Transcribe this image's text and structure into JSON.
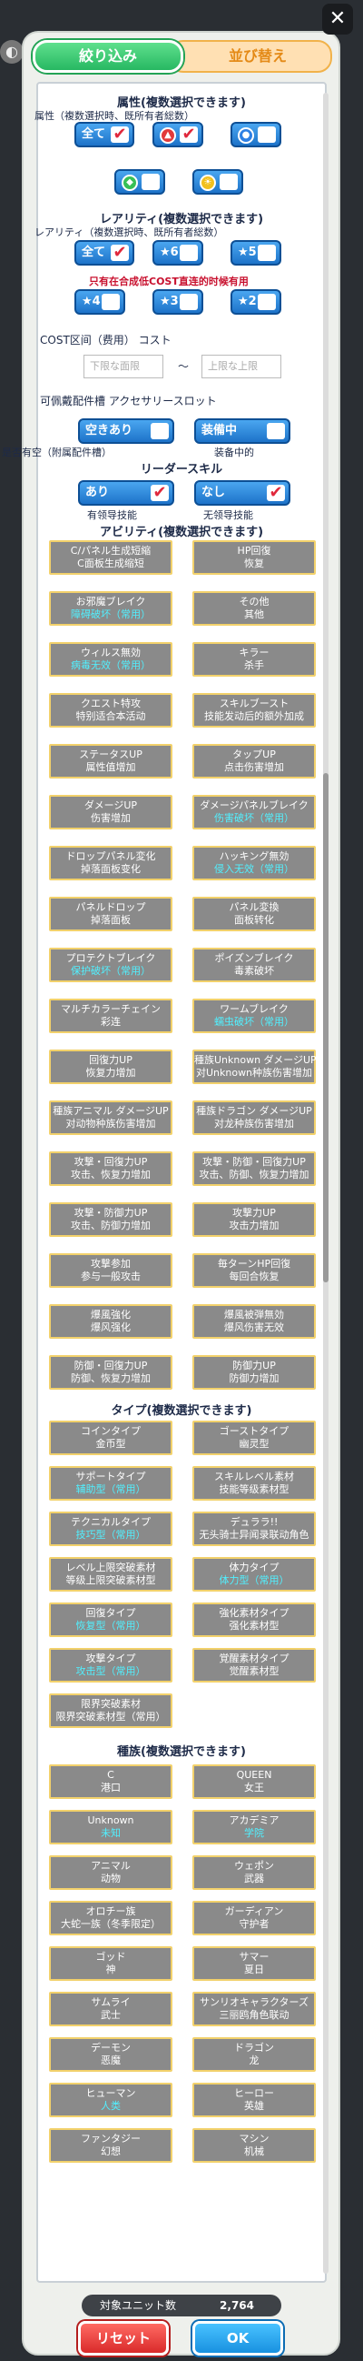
{
  "header": {
    "close": "✕",
    "tab_filter": "絞り込み",
    "tab_sort": "並び替え"
  },
  "attr": {
    "heading": "属性(複数選択できます)",
    "sub": "属性（複数選択時、既所有者総数）",
    "all": "全て",
    "fire": "✕",
    "water": "💧",
    "wind": "",
    "light": ""
  },
  "rarity": {
    "heading": "レアリティ(複数選択できます)",
    "sub": "レアリティ（複数選択時、既所有者総数）",
    "all": "全て",
    "r6": "★6",
    "r5": "★5",
    "note": "只有在合成低COST直连的时候有用",
    "r4": "★4",
    "r3": "★3",
    "r2": "★2"
  },
  "cost": {
    "sub": "COST区间（费用） コスト",
    "min_ph": "下限な面限",
    "tilde": "～",
    "max_ph": "上限な上限"
  },
  "accessory": {
    "sub": "可佩戴配件槽 アクセサリースロット",
    "free": "空きあり",
    "equipped": "装備中"
  },
  "leader": {
    "sub_left": "是否有空（附属配件槽）",
    "sub_right": "装备中的",
    "heading": "リーダースキル",
    "yes": "あり",
    "no": "なし",
    "yes_sub": "有领导技能",
    "no_sub": "无领导技能"
  },
  "ability": {
    "heading": "アビリティ(複数選択できます)",
    "items": [
      {
        "t": "C/パネル生成短縮",
        "s": "C面板生成缩短",
        "blue": false
      },
      {
        "t": "HP回復",
        "s": "恢复",
        "blue": false
      },
      {
        "t": "お邪魔ブレイク",
        "s": "障碍破坏（常用）",
        "blue": true
      },
      {
        "t": "その他",
        "s": "其他",
        "blue": false
      },
      {
        "t": "ウィルス無効",
        "s": "病毒无效（常用）",
        "blue": true
      },
      {
        "t": "キラー",
        "s": "杀手",
        "blue": false
      },
      {
        "t": "クエスト特攻",
        "s": "特别适合本活动",
        "blue": false
      },
      {
        "t": "スキルブースト",
        "s": "技能发动后的额外加成",
        "blue": false
      },
      {
        "t": "ステータスUP",
        "s": "属性值增加",
        "blue": false
      },
      {
        "t": "タップUP",
        "s": "点击伤害增加",
        "blue": false
      },
      {
        "t": "ダメージUP",
        "s": "伤害增加",
        "blue": false
      },
      {
        "t": "ダメージパネルブレイク",
        "s": "伤害破坏（常用）",
        "blue": true
      },
      {
        "t": "ドロップパネル変化",
        "s": "掉落面板变化",
        "blue": false
      },
      {
        "t": "ハッキング無効",
        "s": "侵入无效（常用）",
        "blue": true
      },
      {
        "t": "パネルドロップ",
        "s": "掉落面板",
        "blue": false
      },
      {
        "t": "パネル変換",
        "s": "面板转化",
        "blue": false
      },
      {
        "t": "プロテクトブレイク",
        "s": "保护破坏（常用）",
        "blue": true
      },
      {
        "t": "ポイズンブレイク",
        "s": "毒素破坏",
        "blue": false
      },
      {
        "t": "マルチカラーチェイン",
        "s": "彩连",
        "blue": false
      },
      {
        "t": "ワームブレイク",
        "s": "蠕虫破坏（常用）",
        "blue": true
      },
      {
        "t": "回復力UP",
        "s": "恢复力增加",
        "blue": false
      },
      {
        "t": "種族Unknown ダメージUP",
        "s": "对Unknown种族伤害增加",
        "blue": false
      },
      {
        "t": "種族アニマル ダメージUP",
        "s": "对动物种族伤害增加",
        "blue": false
      },
      {
        "t": "種族ドラゴン ダメージUP",
        "s": "对龙种族伤害增加",
        "blue": false
      },
      {
        "t": "攻撃・回復力UP",
        "s": "攻击、恢复力增加",
        "blue": false
      },
      {
        "t": "攻撃・防御・回復力UP",
        "s": "攻击、防御、恢复力增加",
        "blue": false
      },
      {
        "t": "攻撃・防御力UP",
        "s": "攻击、防御力增加",
        "blue": false
      },
      {
        "t": "攻撃力UP",
        "s": "攻击力增加",
        "blue": false
      },
      {
        "t": "攻撃参加",
        "s": "参与一般攻击",
        "blue": false
      },
      {
        "t": "毎ターンHP回復",
        "s": "每回合恢复",
        "blue": false
      },
      {
        "t": "爆風強化",
        "s": "爆风强化",
        "blue": false
      },
      {
        "t": "爆風被弾無効",
        "s": "爆风伤害无效",
        "blue": false
      },
      {
        "t": "防御・回復力UP",
        "s": "防御、恢复力增加",
        "blue": false
      },
      {
        "t": "防御力UP",
        "s": "防御力增加",
        "blue": false
      }
    ]
  },
  "type": {
    "heading": "タイプ(複数選択できます)",
    "items": [
      {
        "t": "コインタイプ",
        "s": "金币型",
        "blue": false
      },
      {
        "t": "ゴーストタイプ",
        "s": "幽灵型",
        "blue": false
      },
      {
        "t": "サポートタイプ",
        "s": "辅助型（常用）",
        "blue": true
      },
      {
        "t": "スキルレベル素材",
        "s": "技能等级素材型",
        "blue": false
      },
      {
        "t": "テクニカルタイプ",
        "s": "技巧型（常用）",
        "blue": true
      },
      {
        "t": "デュララ!!",
        "s": "无头骑士异闻录联动角色",
        "blue": false
      },
      {
        "t": "レベル上限突破素材",
        "s": "等级上限突破素材型",
        "blue": false
      },
      {
        "t": "体力タイプ",
        "s": "体力型（常用）",
        "blue": true
      },
      {
        "t": "回復タイプ",
        "s": "恢复型（常用）",
        "blue": true
      },
      {
        "t": "強化素材タイプ",
        "s": "强化素材型",
        "blue": false
      },
      {
        "t": "攻撃タイプ",
        "s": "攻击型（常用）",
        "blue": true
      },
      {
        "t": "覚醒素材タイプ",
        "s": "觉醒素材型",
        "blue": false
      },
      {
        "t": "限界突破素材",
        "s": "限界突破素材型（常用）",
        "blue": false
      }
    ]
  },
  "race": {
    "heading": "種族(複数選択できます)",
    "items": [
      {
        "t": "C",
        "s": "港口",
        "blue": false
      },
      {
        "t": "QUEEN",
        "s": "女王",
        "blue": false
      },
      {
        "t": "Unknown",
        "s": "未知",
        "blue": true
      },
      {
        "t": "アカデミア",
        "s": "学院",
        "blue": true
      },
      {
        "t": "アニマル",
        "s": "动物",
        "blue": false
      },
      {
        "t": "ウェポン",
        "s": "武器",
        "blue": false
      },
      {
        "t": "オロチー族",
        "s": "大蛇一族（冬季限定）",
        "blue": false
      },
      {
        "t": "ガーディアン",
        "s": "守护者",
        "blue": false
      },
      {
        "t": "ゴッド",
        "s": "神",
        "blue": false
      },
      {
        "t": "サマー",
        "s": "夏日",
        "blue": false
      },
      {
        "t": "サムライ",
        "s": "武士",
        "blue": false
      },
      {
        "t": "サンリオキャラクターズ",
        "s": "三丽鸥角色联动",
        "blue": false
      },
      {
        "t": "デーモン",
        "s": "恶魔",
        "blue": false
      },
      {
        "t": "ドラゴン",
        "s": "龙",
        "blue": false
      },
      {
        "t": "ヒューマン",
        "s": "人类",
        "blue": true
      },
      {
        "t": "ヒーロー",
        "s": "英雄",
        "blue": false
      },
      {
        "t": "ファンタジー",
        "s": "幻想",
        "blue": false
      },
      {
        "t": "マシン",
        "s": "机械",
        "blue": false
      }
    ]
  },
  "footer": {
    "count_label": "対象ユニット数",
    "count_value": "2,764",
    "reset": "リセット",
    "ok": "OK"
  }
}
